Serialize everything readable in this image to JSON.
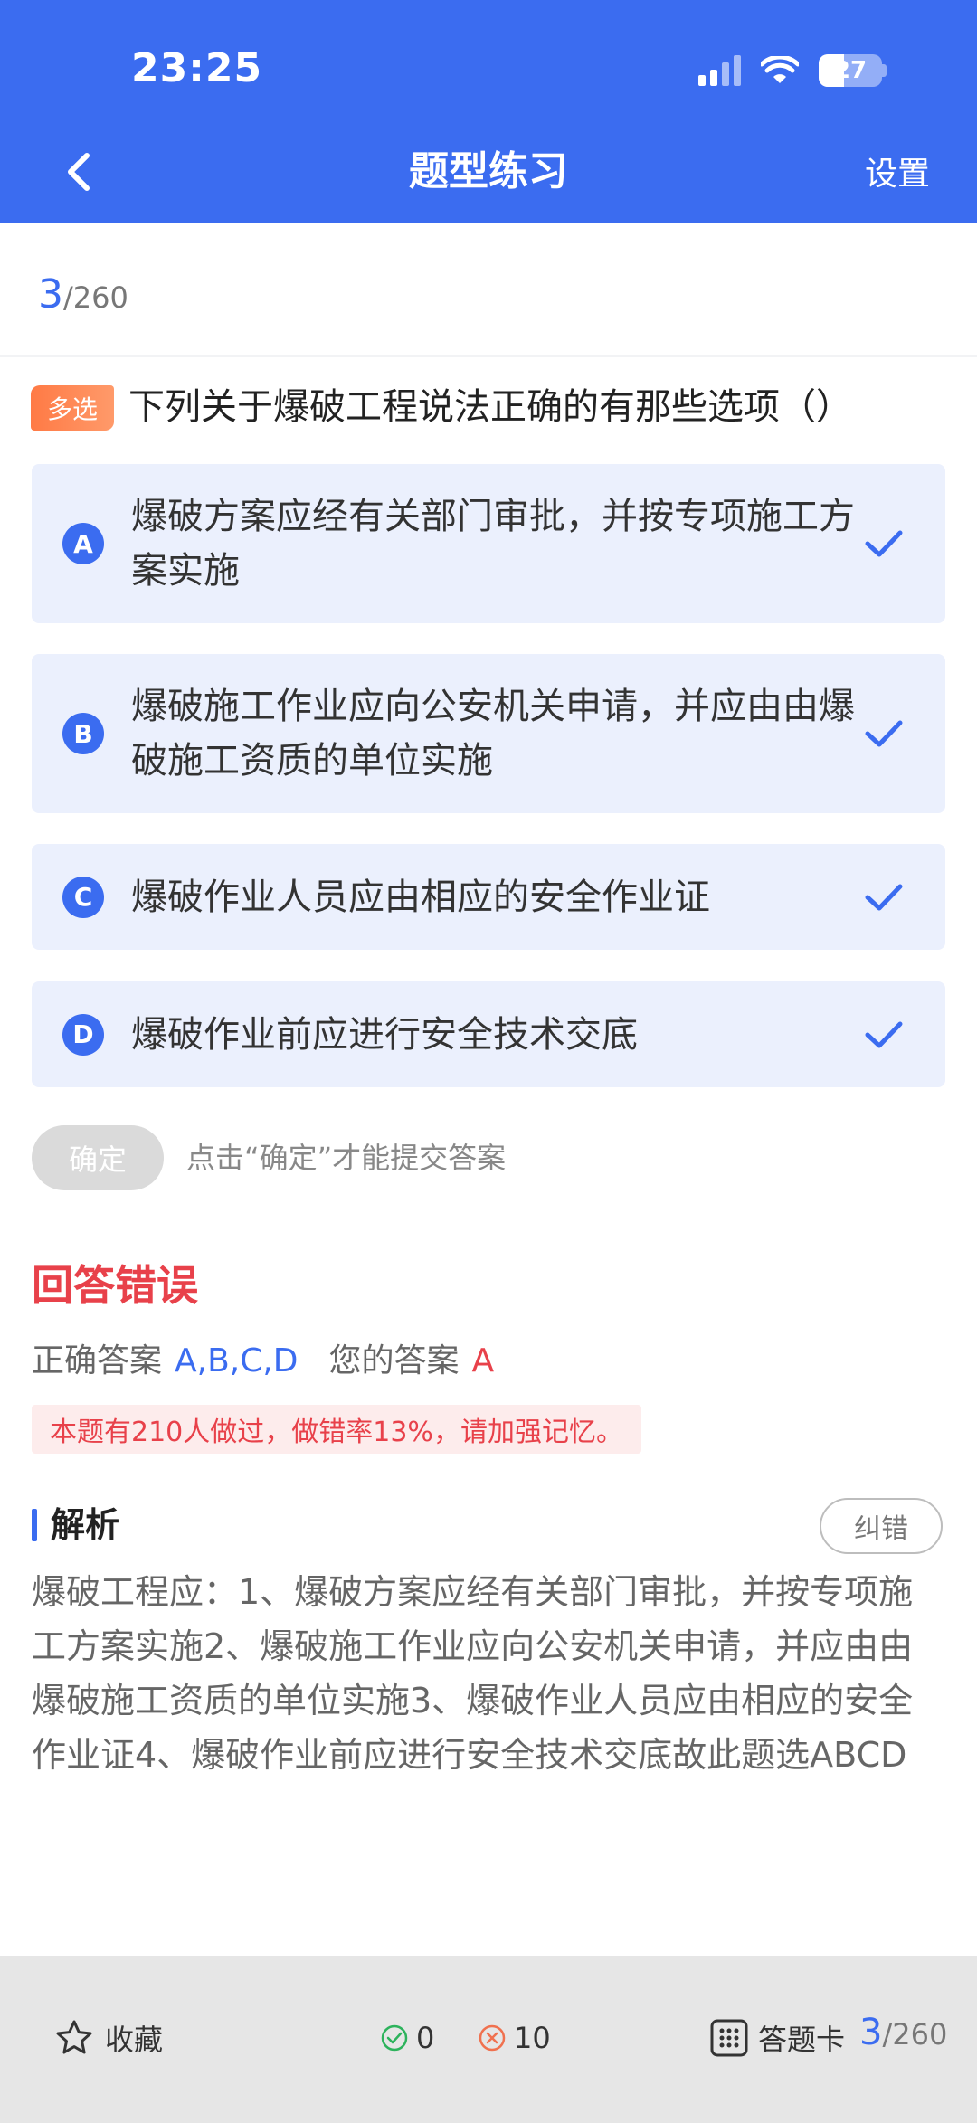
{
  "status_bar": {
    "time": "23:25",
    "battery": "27"
  },
  "header": {
    "title": "题型练习",
    "settings_label": "设置"
  },
  "progress": {
    "current": "3",
    "total": "/260"
  },
  "question": {
    "type_tag": "多选",
    "text": "下列关于爆破工程说法正确的有那些选项（）",
    "options": [
      {
        "letter": "A",
        "text": "爆破方案应经有关部门审批，并按专项施工方案实施"
      },
      {
        "letter": "B",
        "text": "爆破施工作业应向公安机关申请，并应由由爆破施工资质的单位实施"
      },
      {
        "letter": "C",
        "text": "爆破作业人员应由相应的安全作业证"
      },
      {
        "letter": "D",
        "text": "爆破作业前应进行安全技术交底"
      }
    ]
  },
  "submit": {
    "confirm_label": "确定",
    "hint": "点击“确定”才能提交答案"
  },
  "result": {
    "title": "回答错误",
    "correct_label": "正确答案",
    "correct_value": "A,B,C,D",
    "yours_label": "您的答案",
    "yours_value": "A",
    "stat": "本题有210人做过，做错率13%，请加强记忆。"
  },
  "analysis": {
    "label": "解析",
    "report_label": "纠错",
    "text": "爆破工程应：1、爆破方案应经有关部门审批，并按专项施工方案实施2、爆破施工作业应向公安机关申请，并应由由爆破施工资质的单位实施3、爆破作业人员应由相应的安全作业证4、爆破作业前应进行安全技术交底故此题选ABCD"
  },
  "bottom_bar": {
    "favorite_label": "收藏",
    "correct_count": "0",
    "wrong_count": "10",
    "answer_card_label": "答题卡",
    "current": "3",
    "total": "/260"
  },
  "colors": {
    "primary": "#3B6CF0",
    "error": "#E8414A",
    "tag": "#FF7A45",
    "option_bg": "#EBF0FD"
  }
}
